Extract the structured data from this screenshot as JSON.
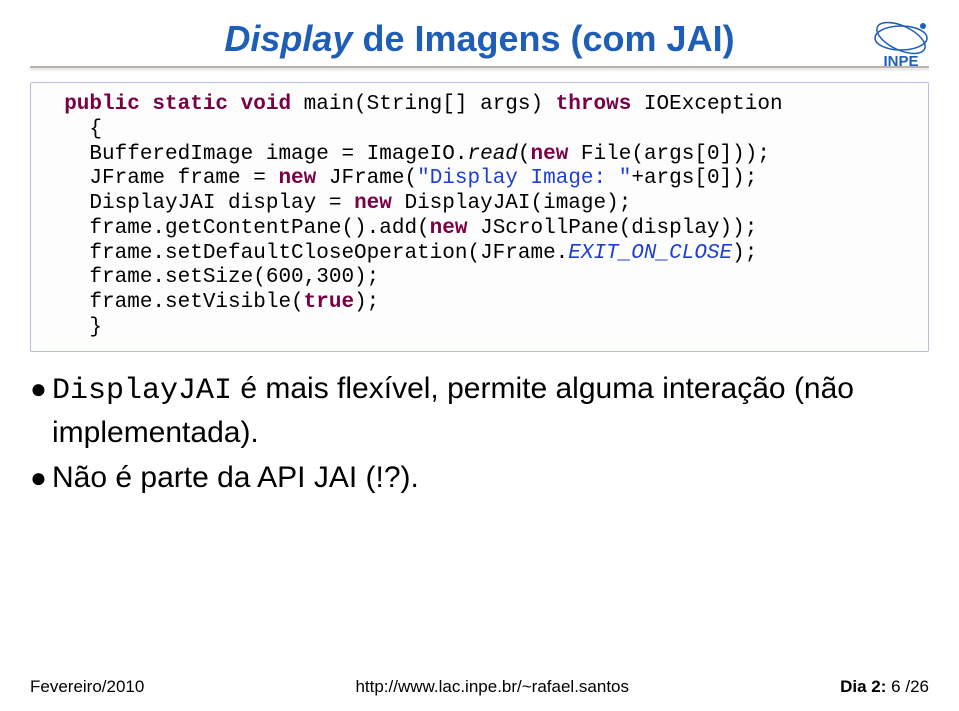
{
  "title": {
    "part1": "Display",
    "part2": " de Imagens (com JAI)"
  },
  "code": {
    "l1a": "  public static void",
    "l1b": " main(String[] args) ",
    "l1c": "throws",
    "l1d": " IOException",
    "l2": "    {",
    "l3a": "    BufferedImage image = ImageIO.",
    "l3b": "read",
    "l3c": "(",
    "l3d": "new",
    "l3e": " File(args[0]));",
    "l4a": "    JFrame frame = ",
    "l4b": "new",
    "l4c": " JFrame(",
    "l4d": "\"Display Image: \"",
    "l4e": "+args[0]);",
    "l5a": "    DisplayJAI display = ",
    "l5b": "new",
    "l5c": " DisplayJAI(image);",
    "l6a": "    frame.getContentPane().add(",
    "l6b": "new",
    "l6c": " JScrollPane(display));",
    "l7a": "    frame.setDefaultCloseOperation(JFrame.",
    "l7b": "EXIT_ON_CLOSE",
    "l7c": ");",
    "l8": "    frame.setSize(600,300);",
    "l9a": "    frame.setVisible(",
    "l9b": "true",
    "l9c": ");",
    "l10": "    }"
  },
  "bullets": {
    "b1_mono": "DisplayJAI",
    "b1_rest": " é mais flexível, permite alguma interação (não implementada).",
    "b2": "Não é parte da API JAI (!?)."
  },
  "footer": {
    "left": "Fevereiro/2010",
    "center": "http://www.lac.inpe.br/~rafael.santos",
    "right_label": "Dia 2: ",
    "right_page": "6",
    "right_total": " /26"
  }
}
